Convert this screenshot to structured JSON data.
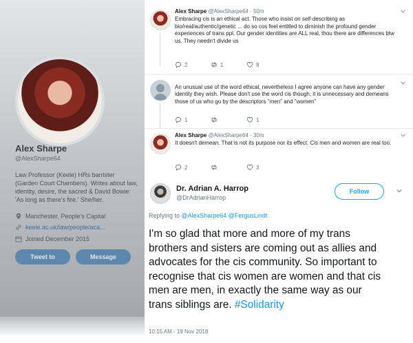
{
  "profile": {
    "name": "Alex Sharpe",
    "handle": "@AlexSharpe64",
    "bio": "Law Professor (Keele) HRs barrister (Garden Court Chambers). Writes about law, identity, desire, the sacred & David Bowie: 'As long as there's fire.' She/her.",
    "location": "Manchester, People's Capital",
    "link": "keele.ac.uk/law/people/aca...",
    "joined": "Joined December 2015",
    "tweet_to_label": "Tweet to",
    "message_label": "Message"
  },
  "thread": [
    {
      "name": "Alex Sharpe",
      "handle": "@AlexSharpe64 · 50m",
      "text": "Embracing cis is an ethical act. Those who insist on self-describing as bio/real/authentic/genetic ... do so cos feel entitled to diminish the profound gender experiences of trans ppl. Our gender identities are ALL real, thou there are differences btw us. They needn't divide us",
      "replies": "2",
      "retweets": "1",
      "likes": "8"
    },
    {
      "name": "",
      "handle": "",
      "text": "An unusual use of the word ethical, nevertheless I agree anyone can have any gender identity they wish. Please don't use the word cis though, it is unnecessary and demeans those of us who go by the descriptors \"men\" and \"women\"",
      "replies": "1",
      "retweets": "",
      "likes": "1"
    },
    {
      "name": "Alex Sharpe",
      "handle": "@AlexSharpe64 · 30m",
      "text": "It doesn't demean. That is not its purpose nor its effect. Cis men and women are real too.",
      "replies": "2",
      "retweets": "",
      "likes": "3"
    }
  ],
  "main_tweet": {
    "name": "Dr. Adrian A. Harrop",
    "handle": "@DrAdrianHarrop",
    "follow_label": "Follow",
    "replying_prefix": "Replying to",
    "replying_mentions": "@AlexSharpe64 @FergusLindt",
    "text": "I'm so glad that more and more of my trans brothers and sisters are coming out as allies and advocates for the cis community. So important to recognise that cis women are women and that cis men are men, in exactly the same way as our trans siblings are.",
    "hashtag": "#Solidarity",
    "timestamp": "10:15 AM - 19 Nov 2018"
  },
  "colors": {
    "accent": "#1da1f2",
    "link": "#1b95e0",
    "muted": "#657786",
    "profile_button": "#5d87ad"
  },
  "icons": [
    "location-pin-icon",
    "link-icon",
    "calendar-icon",
    "reply-icon",
    "retweet-icon",
    "heart-icon",
    "chevron-down-icon"
  ]
}
